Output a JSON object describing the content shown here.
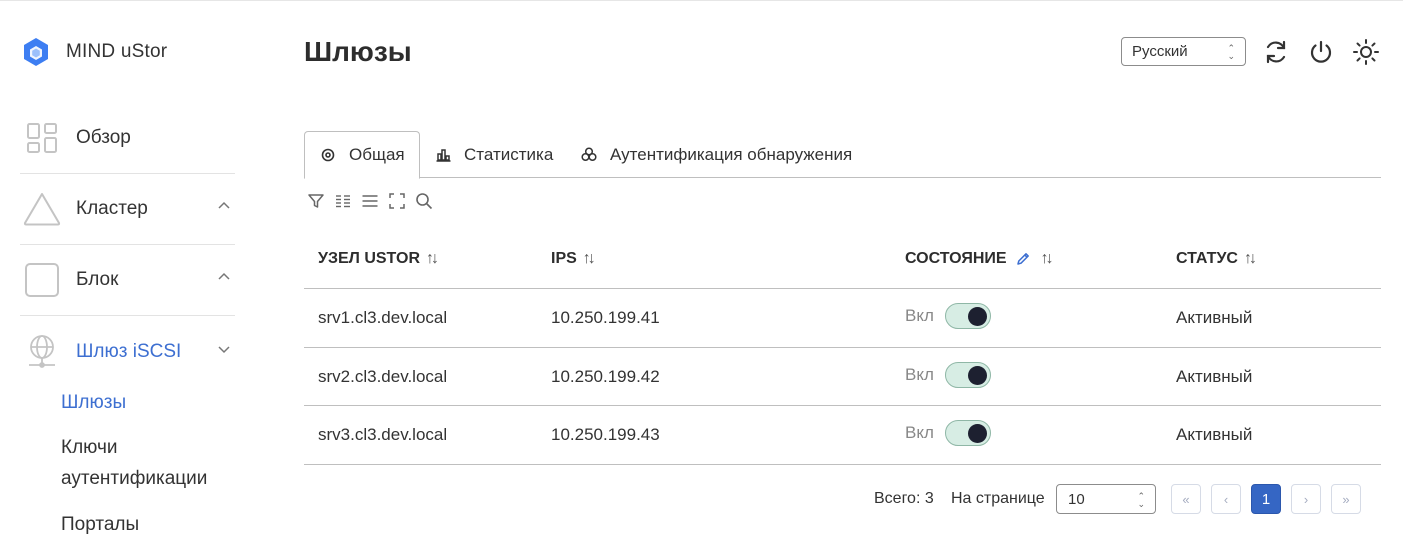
{
  "app": {
    "name": "MIND uStor"
  },
  "sidebar": {
    "items": [
      {
        "label": "Обзор",
        "icon": "dashboard-icon"
      },
      {
        "label": "Кластер",
        "icon": "triangle-icon"
      },
      {
        "label": "Блок",
        "icon": "square-icon"
      },
      {
        "label": "Шлюз iSCSI",
        "icon": "network-globe-icon"
      }
    ],
    "subitems": [
      {
        "label": "Шлюзы"
      },
      {
        "label": "Ключи аутентификации"
      },
      {
        "label": "Порталы"
      }
    ]
  },
  "header": {
    "title": "Шлюзы",
    "language": "Русский"
  },
  "tabs": [
    {
      "label": "Общая",
      "icon": "target-icon"
    },
    {
      "label": "Статистика",
      "icon": "bar-chart-icon"
    },
    {
      "label": "Аутентификация обнаружения",
      "icon": "users-icon"
    }
  ],
  "table": {
    "columns": [
      "УЗЕЛ USTOR",
      "IPS",
      "СОСТОЯНИЕ",
      "СТАТУС"
    ],
    "rows": [
      {
        "node": "srv1.cl3.dev.local",
        "ip": "10.250.199.41",
        "state_label": "Вкл",
        "state_on": true,
        "status": "Активный"
      },
      {
        "node": "srv2.cl3.dev.local",
        "ip": "10.250.199.42",
        "state_label": "Вкл",
        "state_on": true,
        "status": "Активный"
      },
      {
        "node": "srv3.cl3.dev.local",
        "ip": "10.250.199.43",
        "state_label": "Вкл",
        "state_on": true,
        "status": "Активный"
      }
    ]
  },
  "pagination": {
    "total_label": "Всего: 3",
    "per_page_label": "На странице",
    "per_page_value": "10",
    "current_page": "1",
    "first": "«",
    "prev": "‹",
    "next": "›",
    "last": "»"
  },
  "colors": {
    "accent": "#3d6fd1",
    "logo": "#3d7ef2",
    "page_button": "#3566c4",
    "toggle_bg": "#d7ede4"
  }
}
